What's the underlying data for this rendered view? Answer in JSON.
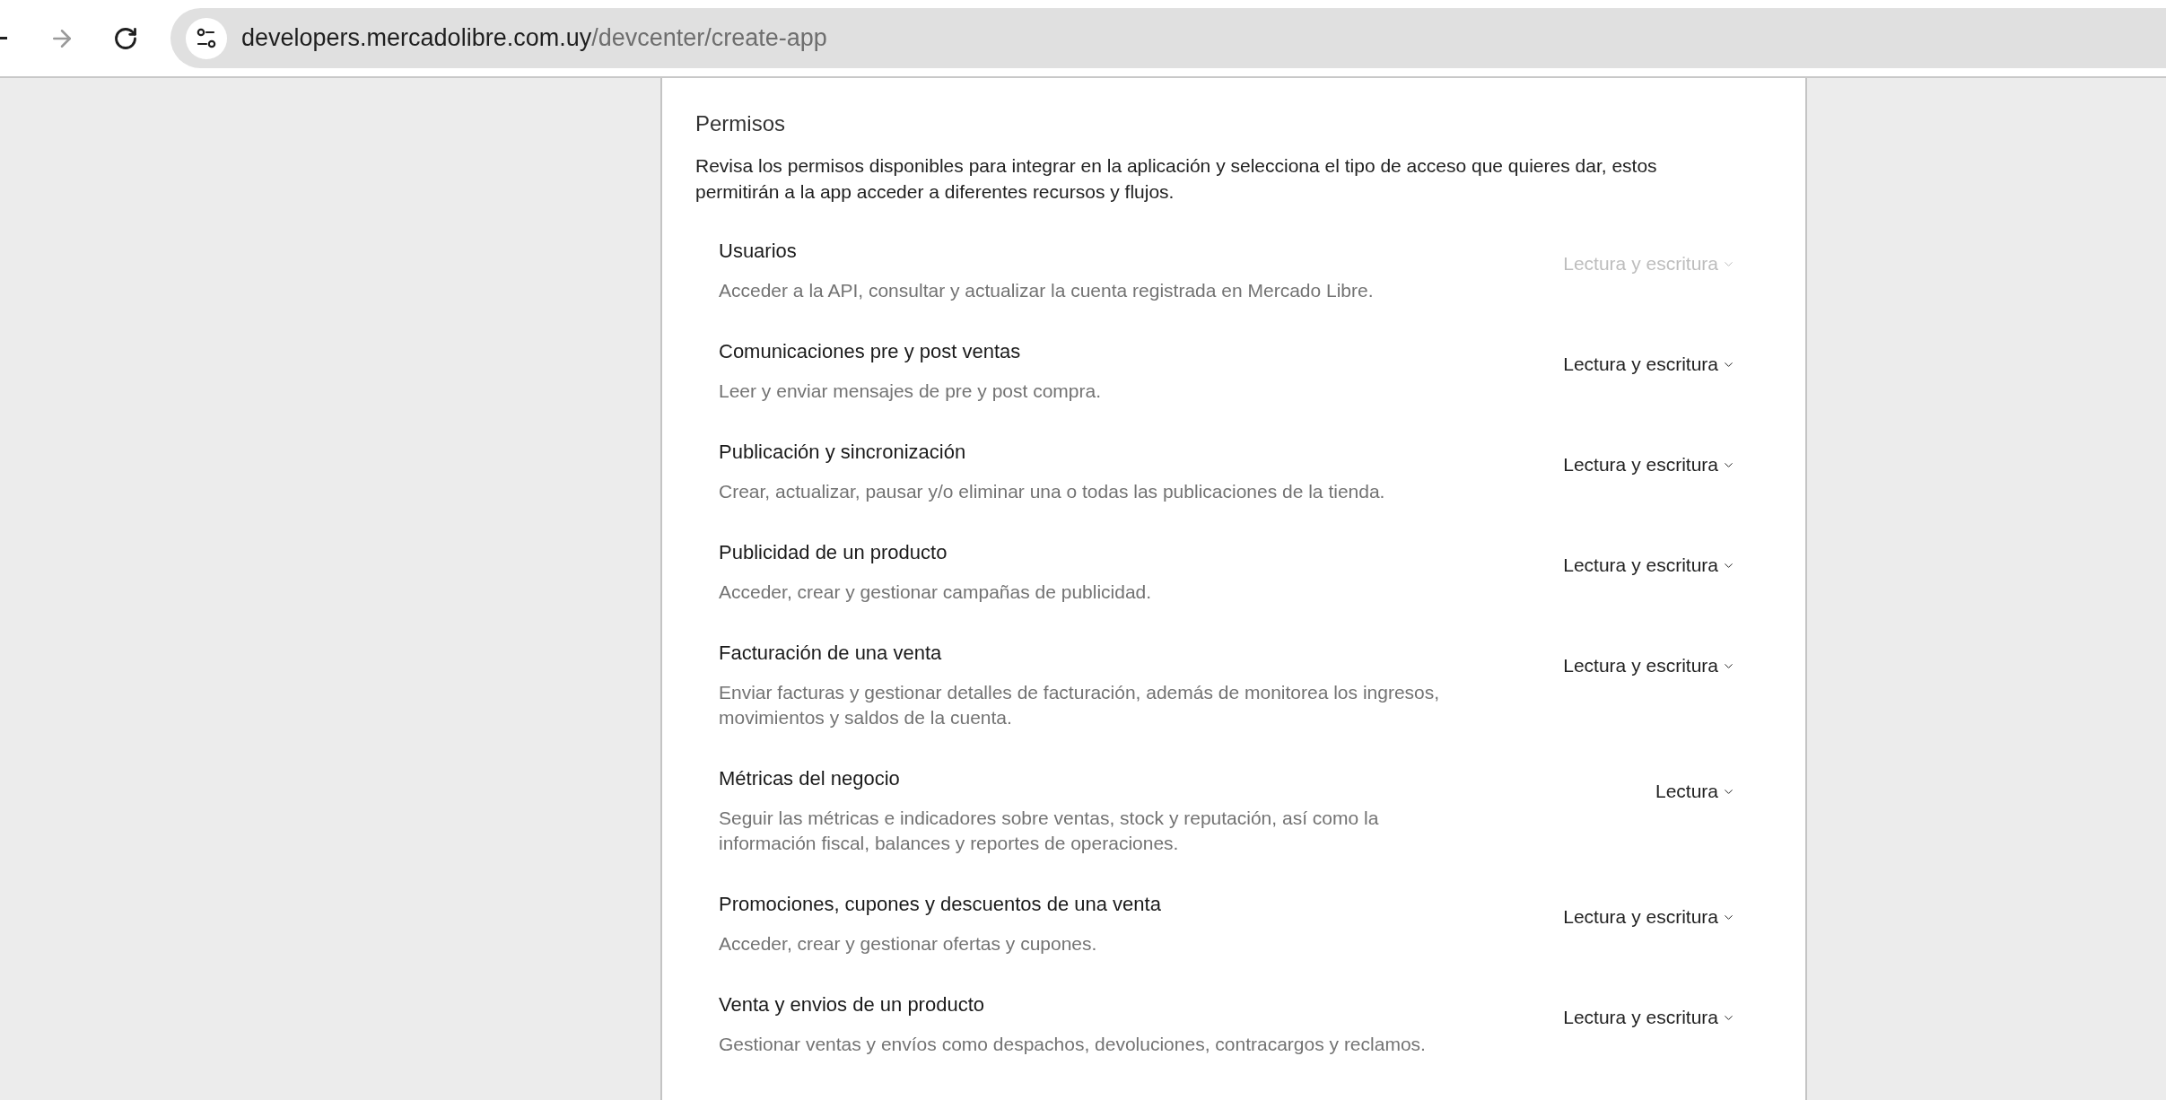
{
  "browser": {
    "url_host": "developers.mercadolibre.com.uy",
    "url_path": "/devcenter/create-app"
  },
  "section": {
    "title": "Permisos",
    "description": "Revisa los permisos disponibles para integrar en la aplicación y selecciona el tipo de acceso que quieres dar, estos permitirán a la app acceder a diferentes recursos y flujos."
  },
  "permissions": [
    {
      "title": "Usuarios",
      "description": "Acceder a la API, consultar y actualizar la cuenta registrada en Mercado Libre.",
      "access": "Lectura y escritura",
      "disabled": true
    },
    {
      "title": "Comunicaciones pre y post ventas",
      "description": "Leer y enviar mensajes de pre y post compra.",
      "access": "Lectura y escritura",
      "disabled": false
    },
    {
      "title": "Publicación y sincronización",
      "description": "Crear, actualizar, pausar y/o eliminar una o todas las publicaciones de la tienda.",
      "access": "Lectura y escritura",
      "disabled": false
    },
    {
      "title": "Publicidad de un producto",
      "description": "Acceder, crear y gestionar campañas de publicidad.",
      "access": "Lectura y escritura",
      "disabled": false
    },
    {
      "title": "Facturación de una venta",
      "description": "Enviar facturas y gestionar detalles de facturación, además de monitorea los ingresos, movimientos y saldos de la cuenta.",
      "access": "Lectura y escritura",
      "disabled": false
    },
    {
      "title": "Métricas del negocio",
      "description": "Seguir las métricas e indicadores sobre ventas, stock y reputación, así como la información fiscal, balances y reportes de operaciones.",
      "access": "Lectura",
      "disabled": false
    },
    {
      "title": "Promociones, cupones y descuentos de una venta",
      "description": "Acceder, crear y gestionar ofertas y cupones.",
      "access": "Lectura y escritura",
      "disabled": false
    },
    {
      "title": "Venta y envios de un producto",
      "description": "Gestionar ventas y envíos como despachos, devoluciones, contracargos y reclamos.",
      "access": "Lectura y escritura",
      "disabled": false
    }
  ]
}
